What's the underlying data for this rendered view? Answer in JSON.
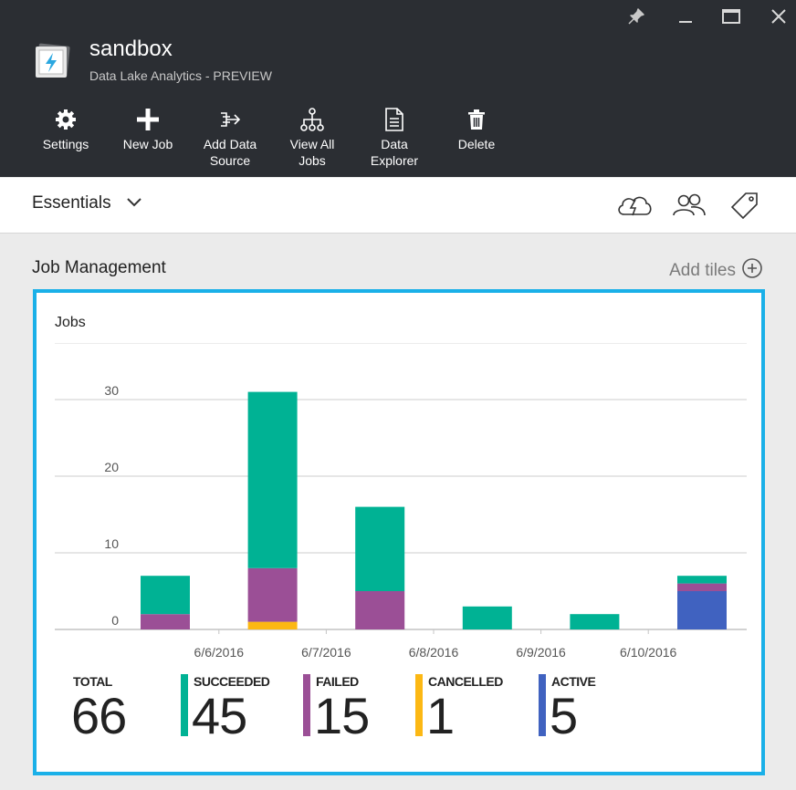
{
  "header": {
    "title": "sandbox",
    "subtitle": "Data Lake Analytics - PREVIEW",
    "toolbar": [
      {
        "label": "Settings",
        "icon": "gear-icon"
      },
      {
        "label": "New Job",
        "icon": "plus-icon"
      },
      {
        "label": "Add Data\nSource",
        "icon": "add-data-source-icon"
      },
      {
        "label": "View All\nJobs",
        "icon": "hierarchy-icon"
      },
      {
        "label": "Data\nExplorer",
        "icon": "document-icon"
      },
      {
        "label": "Delete",
        "icon": "trash-icon"
      }
    ],
    "window_controls": [
      "pin-icon",
      "minimize-icon",
      "maximize-icon",
      "close-icon"
    ]
  },
  "essentials": {
    "label": "Essentials",
    "icons": [
      "cloud-lightning-icon",
      "users-icon",
      "tag-icon"
    ]
  },
  "section": {
    "title": "Job Management",
    "add_tiles_label": "Add tiles"
  },
  "tile": {
    "title": "Jobs",
    "colors": {
      "succeeded": "#00b294",
      "failed": "#9b4f96",
      "cancelled": "#fcb814",
      "active": "#4062c0",
      "border": "#1ab0e8"
    },
    "stats": [
      {
        "label": "TOTAL",
        "value": "66",
        "color": ""
      },
      {
        "label": "SUCCEEDED",
        "value": "45",
        "color": "#00b294"
      },
      {
        "label": "FAILED",
        "value": "15",
        "color": "#9b4f96"
      },
      {
        "label": "CANCELLED",
        "value": "1",
        "color": "#fcb814"
      },
      {
        "label": "ACTIVE",
        "value": "5",
        "color": "#4062c0"
      }
    ]
  },
  "chart_data": {
    "type": "bar",
    "stacked": true,
    "title": "Jobs",
    "x_tick_labels": [
      "6/6/2016",
      "6/7/2016",
      "6/8/2016",
      "6/9/2016",
      "6/10/2016"
    ],
    "y_ticks": [
      0,
      10,
      20,
      30
    ],
    "ylim": [
      0,
      31
    ],
    "grid": true,
    "series": [
      {
        "name": "SUCCEEDED",
        "color": "#00b294",
        "values": [
          5,
          23,
          11,
          3,
          2,
          1
        ]
      },
      {
        "name": "FAILED",
        "color": "#9b4f96",
        "values": [
          2,
          7,
          5,
          0,
          0,
          1
        ]
      },
      {
        "name": "CANCELLED",
        "color": "#fcb814",
        "values": [
          0,
          1,
          0,
          0,
          0,
          0
        ]
      },
      {
        "name": "ACTIVE",
        "color": "#4062c0",
        "values": [
          0,
          0,
          0,
          0,
          0,
          5
        ]
      }
    ]
  }
}
